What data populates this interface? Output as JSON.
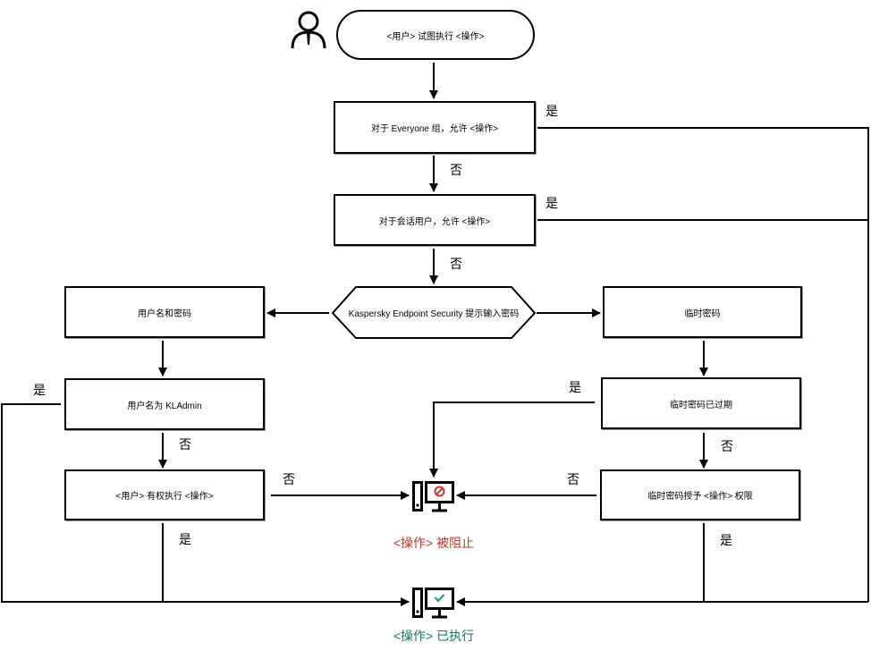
{
  "diagram": {
    "start": {
      "text": "<用户> 试图执行 <操作>",
      "icon": "user-icon"
    },
    "check_everyone": {
      "text": "对于 Everyone 组，允许 <操作>"
    },
    "check_session_user": {
      "text": "对于会话用户，允许 <操作>"
    },
    "prompt": {
      "text": "Kaspersky Endpoint Security 提示输入密码"
    },
    "username_password": {
      "text": "用户名和密码"
    },
    "is_kladmin": {
      "text": "用户名为 KLAdmin"
    },
    "user_has_rights": {
      "text": "<用户> 有权执行 <操作>"
    },
    "temp_password": {
      "text": "临时密码"
    },
    "temp_expired": {
      "text": "临时密码已过期"
    },
    "temp_grants": {
      "text": "临时密码授予 <操作> 权限"
    },
    "blocked": {
      "text": "<操作> 被阻止",
      "icon": "computer-blocked-icon",
      "color": "#b03a2e"
    },
    "executed": {
      "text": "<操作> 已执行",
      "icon": "computer-allowed-icon",
      "color": "#1a6f64"
    },
    "labels": {
      "yes": "是",
      "no": "否"
    },
    "check_color": "#1aa37a",
    "block_color": "#c0392b"
  }
}
